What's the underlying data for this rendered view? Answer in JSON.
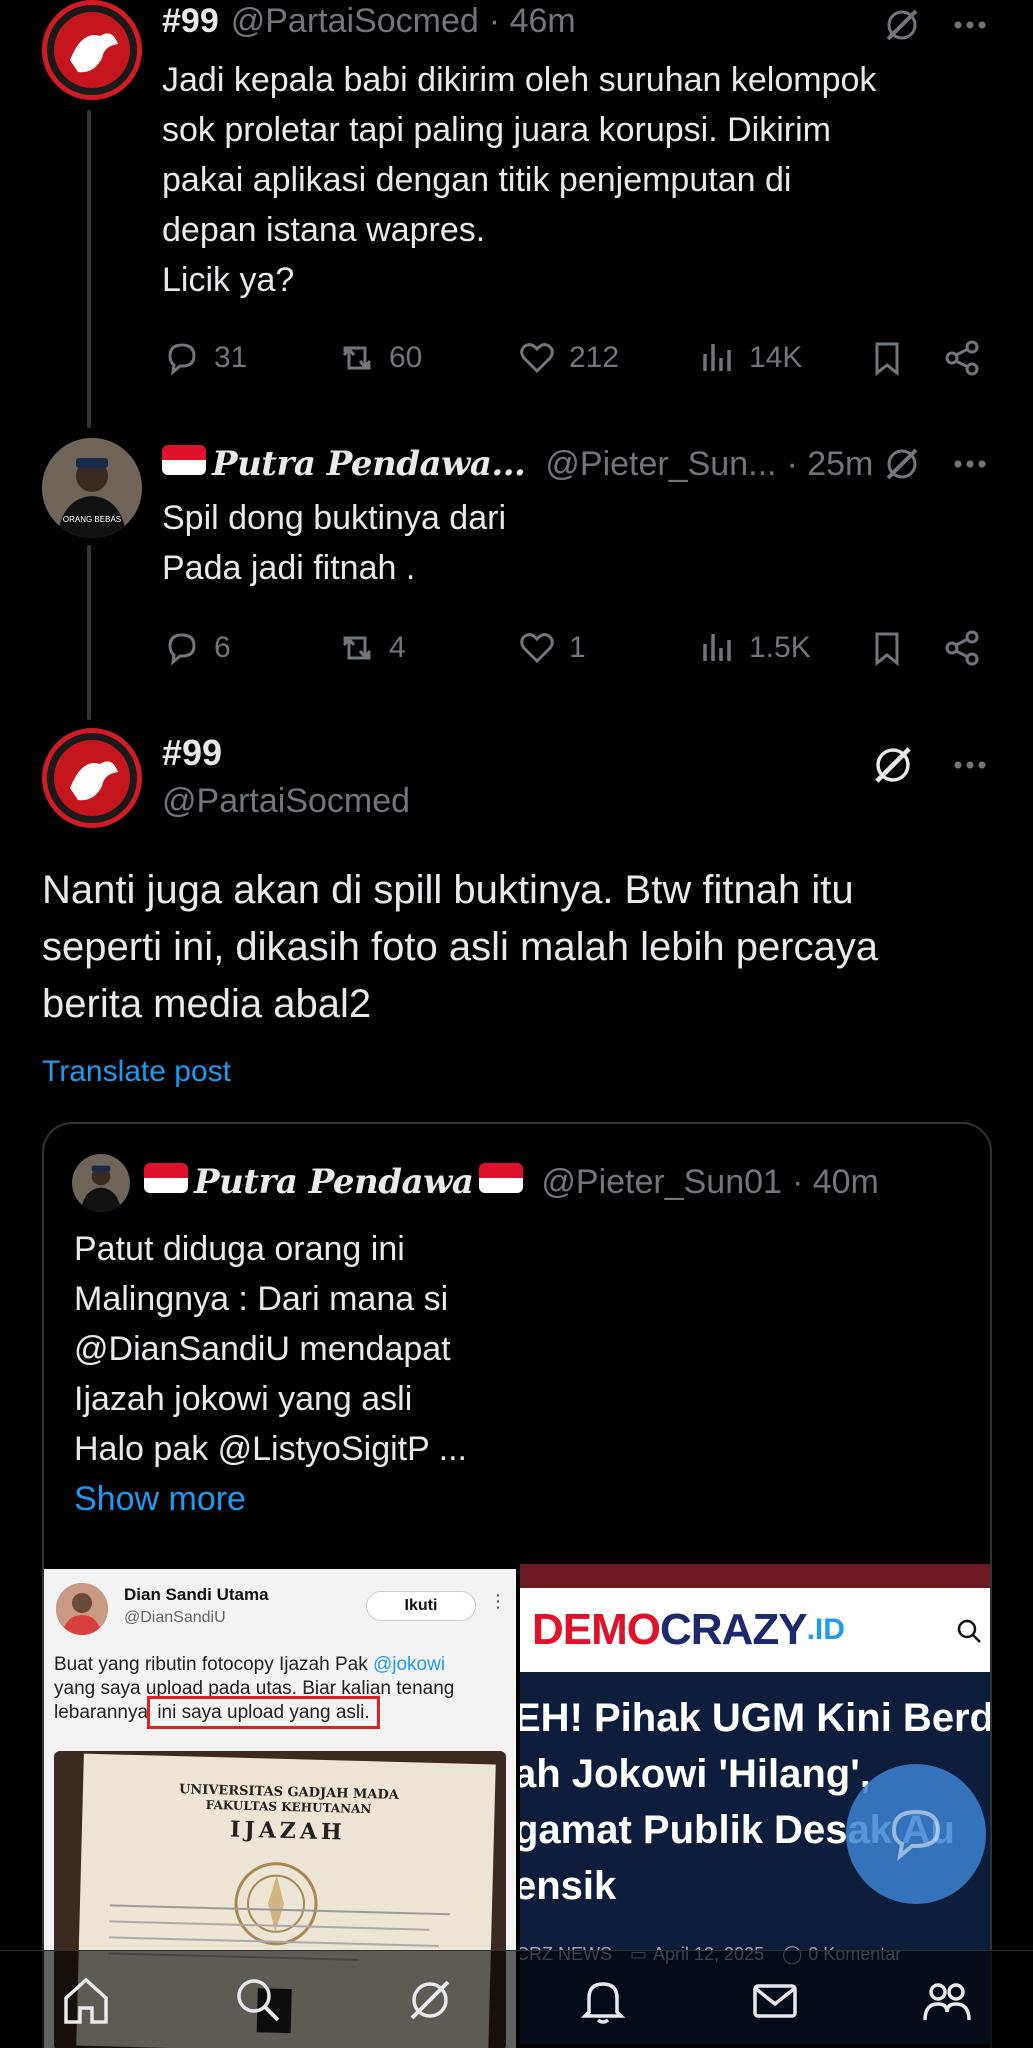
{
  "post1": {
    "name": "#99",
    "handle": "@PartaiSocmed",
    "time": "· 46m",
    "lines": [
      "Jadi kepala babi dikirim oleh suruhan kelompok",
      "sok proletar tapi paling juara korupsi. Dikirim",
      "pakai aplikasi dengan titik penjemputan di",
      "depan istana wapres.",
      "Licik ya?"
    ],
    "replies": "31",
    "reposts": "60",
    "likes": "212",
    "views": "14K"
  },
  "post2": {
    "name": "Putra Pendawa...",
    "handle": "@Pieter_Sun...",
    "time": "· 25m",
    "lines": [
      "Spil dong buktinya dari",
      "Pada jadi fitnah ."
    ],
    "replies": "6",
    "reposts": "4",
    "likes": "1",
    "views": "1.5K"
  },
  "main": {
    "name": "#99",
    "handle": "@PartaiSocmed",
    "lines": [
      "Nanti juga akan di spill buktinya. Btw fitnah itu",
      "seperti ini, dikasih foto asli malah lebih percaya",
      "berita media abal2"
    ],
    "translate": "Translate post"
  },
  "quote": {
    "name": "Putra Pendawa",
    "handle": "@Pieter_Sun01",
    "time": "· 40m",
    "lines": [
      "Patut diduga orang ini",
      "Malingnya : Dari mana si",
      "@DianSandiU mendapat",
      "Ijazah jokowi yang asli",
      "Halo pak @ListyoSigitP ..."
    ],
    "show_more": "Show more"
  },
  "media_left": {
    "name": "Dian Sandi Utama",
    "handle": "@DianSandiU",
    "follow": "Ikuti",
    "text1": "Buat yang ributin fotocopy Ijazah Pak",
    "mention": "@jokowi",
    "text2": "yang saya upload pada utas. Biar kalian tenang",
    "text3": "lebarannya",
    "highlight": "ini saya upload yang asli.",
    "doc_title1": "UNIVERSITAS GADJAH MADA",
    "doc_title2": "FAKULTAS KEHUTANAN",
    "doc_title3": "IJAZAH"
  },
  "media_right": {
    "brand_a": "DEMO",
    "brand_b": "CRAZY",
    "brand_c": ".ID",
    "headline": [
      "EH! Pihak UGM Kini Berd",
      "ah Jokowi 'Hilang',",
      "gamat Publik Desak Au",
      "ensik"
    ],
    "meta_source": "CRZ NEWS",
    "meta_date": "April 12, 2025",
    "meta_comments": "0 Komentar"
  },
  "colors": {
    "accent": "#1d9bf0",
    "muted": "#71767b",
    "brand_red": "#e0122b"
  }
}
